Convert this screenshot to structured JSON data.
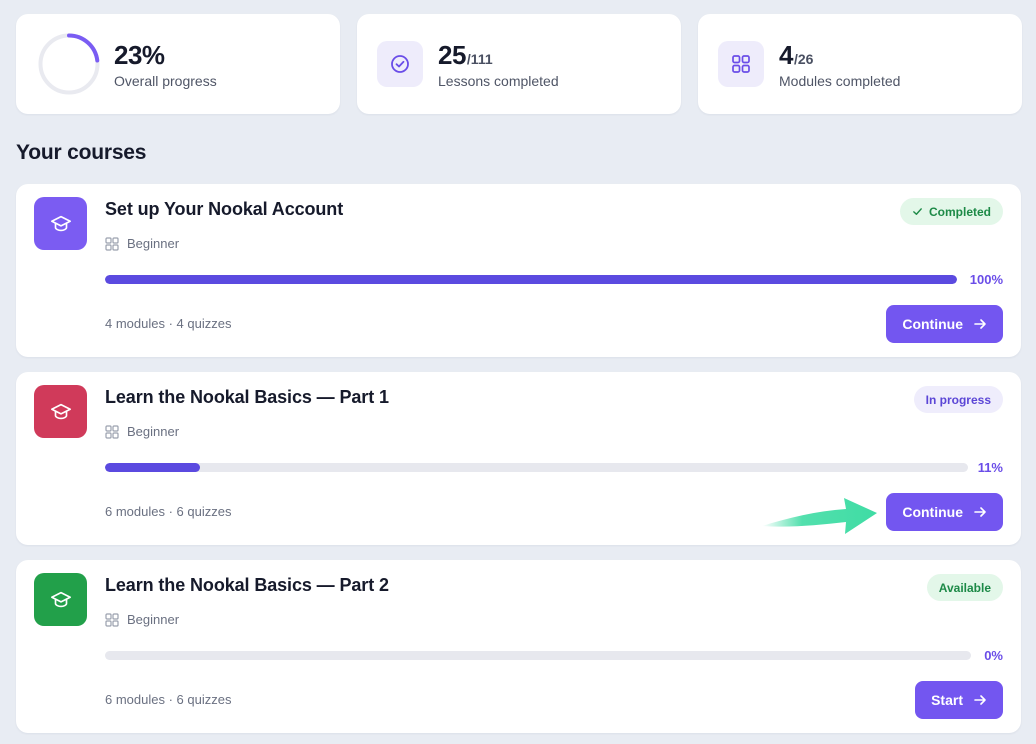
{
  "stats": {
    "overall": {
      "value": "23%",
      "label": "Overall progress",
      "progress": 0.23
    },
    "lessons": {
      "value": "25",
      "total": "/111",
      "label": "Lessons completed",
      "icon": "check-circle-icon"
    },
    "modules": {
      "value": "4",
      "total": "/26",
      "label": "Modules completed",
      "icon": "grid-icon"
    }
  },
  "section_title": "Your courses",
  "courses": [
    {
      "title": "Set up Your Nookal Account",
      "level": "Beginner",
      "badge": "Completed",
      "progress_label": "100%",
      "progress": 1.0,
      "meta": "4 modules · 4 quizzes",
      "button": "Continue",
      "icon_color": "#7b5cf2"
    },
    {
      "title": "Learn the Nookal Basics — Part 1",
      "level": "Beginner",
      "badge": "In progress",
      "progress_label": "11%",
      "progress": 0.11,
      "meta": "6 modules · 6 quizzes",
      "button": "Continue",
      "icon_color": "#d03a5a"
    },
    {
      "title": "Learn the Nookal Basics — Part 2",
      "level": "Beginner",
      "badge": "Available",
      "progress_label": "0%",
      "progress": 0,
      "meta": "6 modules · 6 quizzes",
      "button": "Start",
      "icon_color": "#22a04a"
    }
  ],
  "colors": {
    "accent": "#7356f0",
    "progress_fill": "#5b4ae0",
    "pointer_arrow": "#3fdca4"
  }
}
